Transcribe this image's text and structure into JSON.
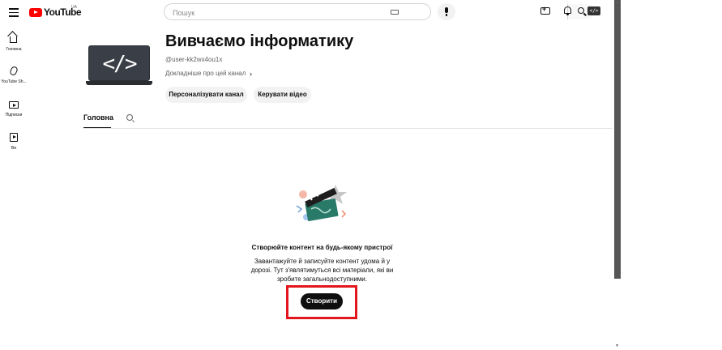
{
  "header": {
    "logo_text": "YouTube",
    "region": "UA",
    "search_placeholder": "Пошук",
    "avatar_text": "</>"
  },
  "sidebar": {
    "items": [
      {
        "label": "Головна",
        "icon": "home-icon"
      },
      {
        "label": "YouTube Sh...",
        "icon": "shorts-icon"
      },
      {
        "label": "Підписки",
        "icon": "subscriptions-icon"
      },
      {
        "label": "Ви",
        "icon": "you-icon"
      }
    ]
  },
  "channel": {
    "art_text": "</>",
    "title": "Вивчаємо інформатику",
    "handle": "@user-kk2wx4ou1x",
    "more_link": "Докладніше про цей канал",
    "customize_label": "Персоналізувати канал",
    "manage_label": "Керувати відео"
  },
  "tabs": {
    "home": "Головна"
  },
  "empty_state": {
    "title": "Створюйте контент на будь-якому пристрої",
    "description": "Завантажуйте й записуйте контент удома й у дорозі. Тут з'являтимуться всі матеріали, які ви зробите загальнодоступними.",
    "create_label": "Створити"
  },
  "colors": {
    "highlight": "#e3151d",
    "brand": "#ff0000"
  }
}
